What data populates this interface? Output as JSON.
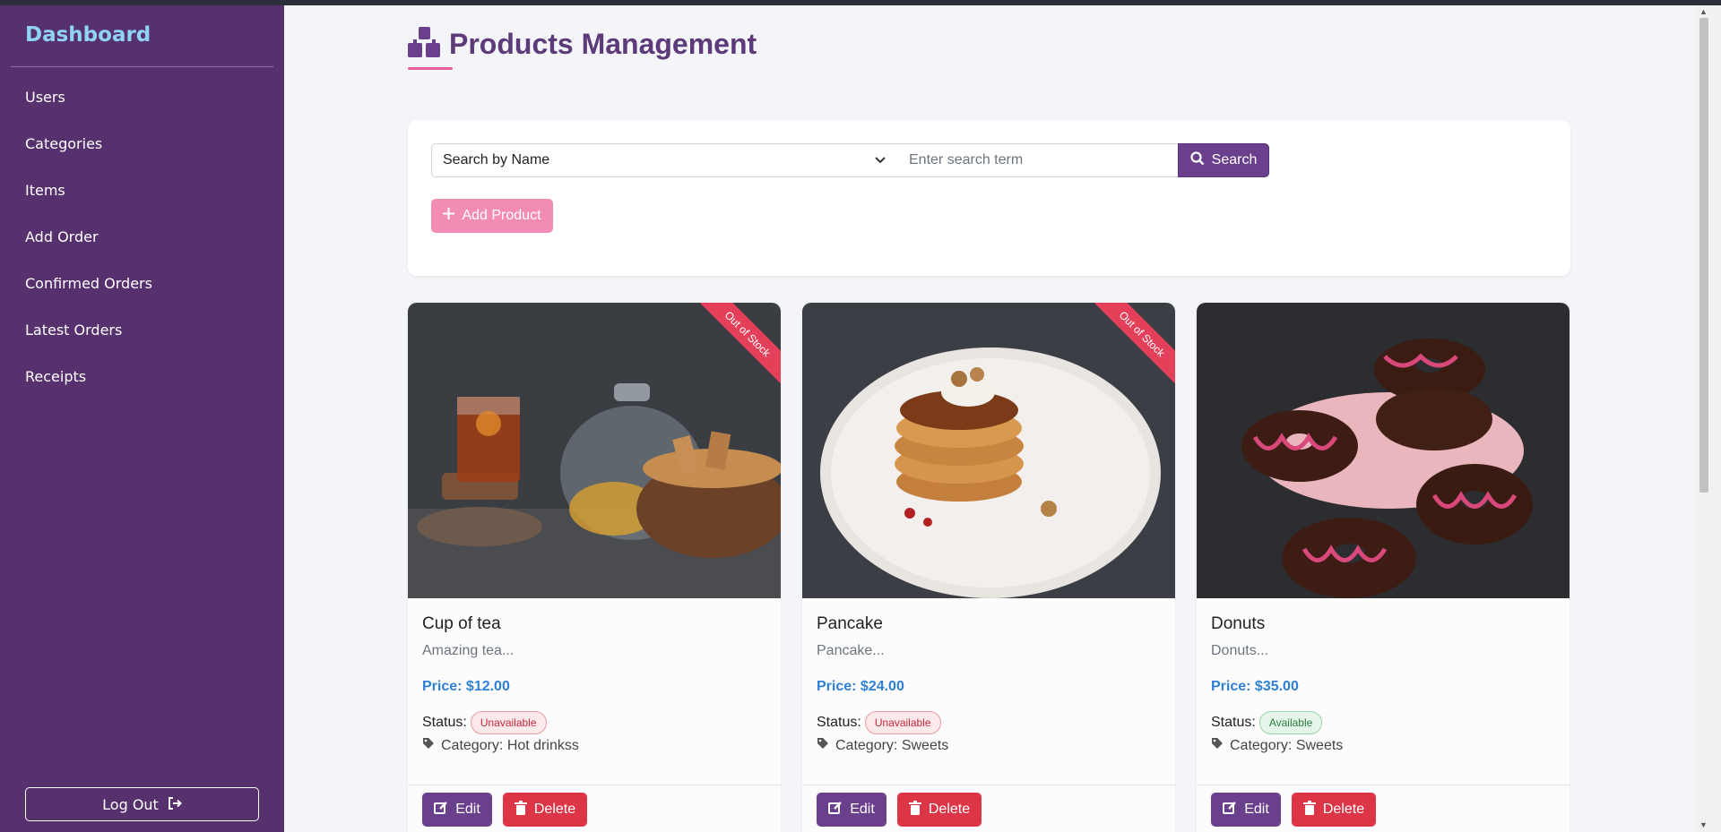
{
  "sidebar": {
    "brand": "Dashboard",
    "items": [
      {
        "label": "Users"
      },
      {
        "label": "Categories"
      },
      {
        "label": "Items"
      },
      {
        "label": "Add Order"
      },
      {
        "label": "Confirmed Orders"
      },
      {
        "label": "Latest Orders"
      },
      {
        "label": "Receipts"
      }
    ],
    "logout_label": "Log Out"
  },
  "header": {
    "title": "Products Management",
    "icon": "cubes-icon"
  },
  "search": {
    "select_value": "Search by Name",
    "placeholder": "Enter search term",
    "button_label": "Search",
    "add_label": "Add Product"
  },
  "products": [
    {
      "name": "Cup of tea",
      "description": "Amazing tea...",
      "price": "Price: $12.00",
      "status_label": "Status:",
      "status": "Unavailable",
      "category": "Category: Hot drinkss",
      "ribbon": "Out of Stock",
      "edit_label": "Edit",
      "delete_label": "Delete"
    },
    {
      "name": "Pancake",
      "description": "Pancake...",
      "price": "Price: $24.00",
      "status_label": "Status:",
      "status": "Unavailable",
      "category": "Category: Sweets",
      "ribbon": "Out of Stock",
      "edit_label": "Edit",
      "delete_label": "Delete"
    },
    {
      "name": "Donuts",
      "description": "Donuts...",
      "price": "Price: $35.00",
      "status_label": "Status:",
      "status": "Available",
      "category": "Category: Sweets",
      "edit_label": "Edit",
      "delete_label": "Delete"
    }
  ],
  "colors": {
    "sidebar": "#57306e",
    "accent": "#6a3f8c",
    "pink": "#f28cb5",
    "danger": "#dc3545",
    "price": "#2f80d6"
  }
}
